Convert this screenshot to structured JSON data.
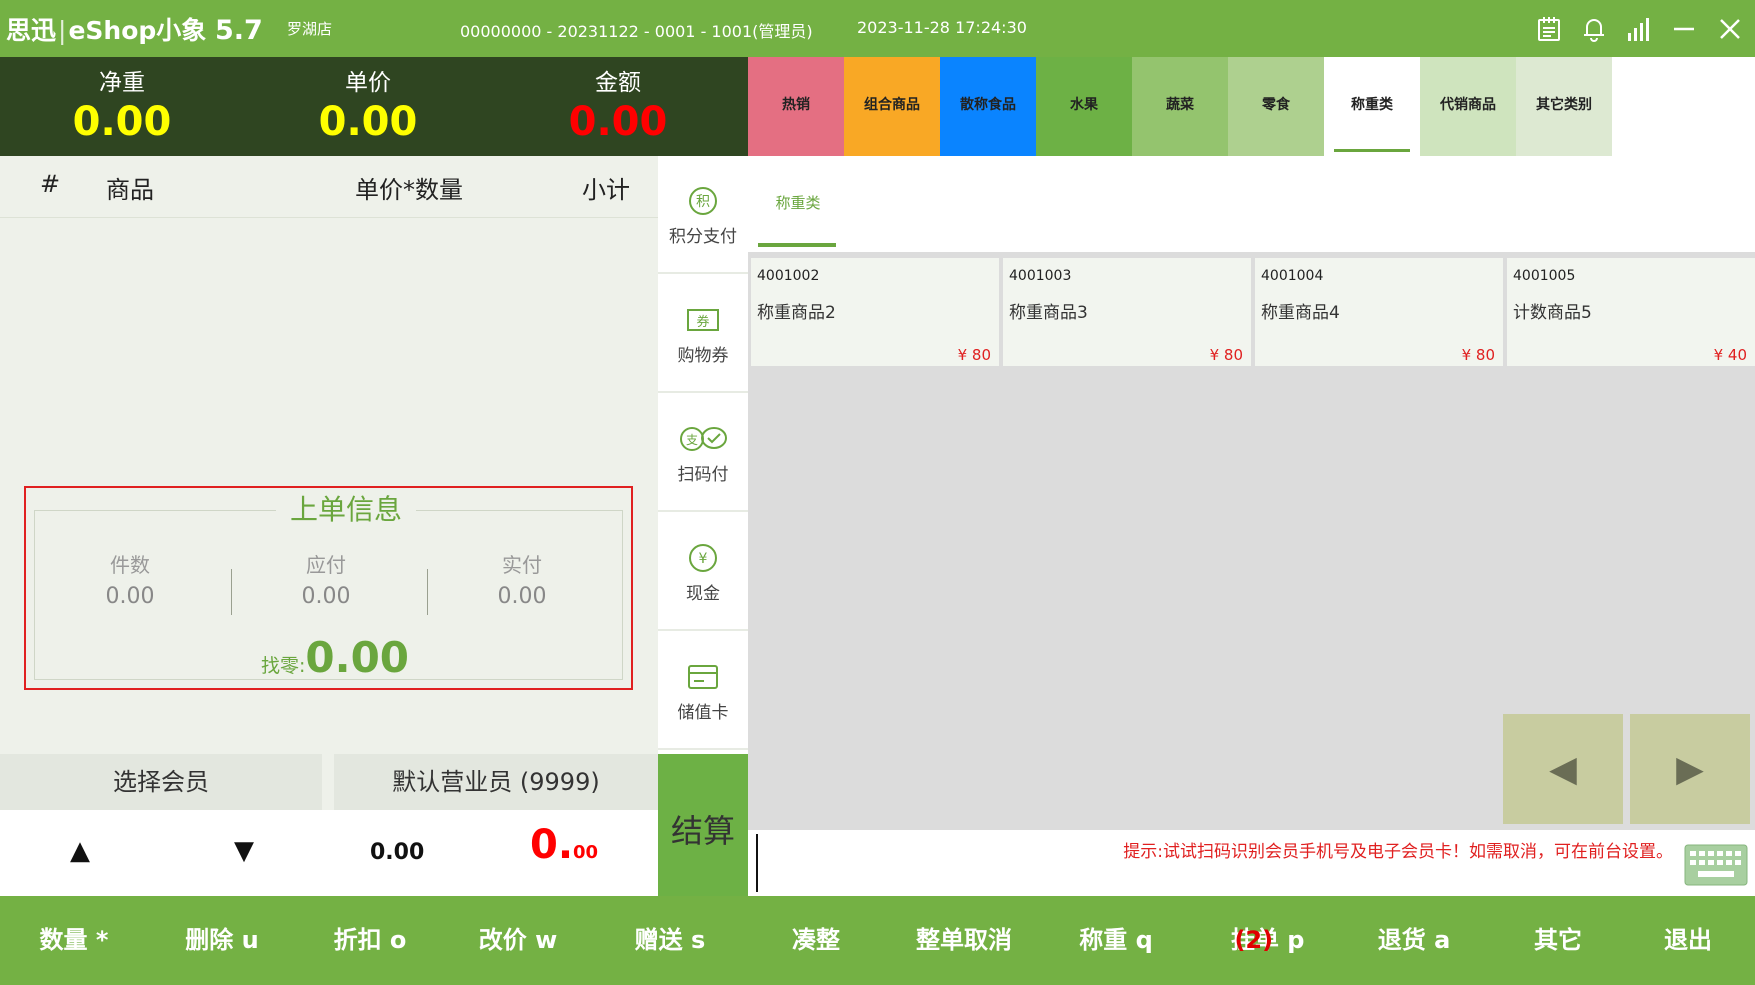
{
  "titlebar": {
    "brand": "思迅",
    "app_name": "eShop小象",
    "version": "5.7",
    "store": "罗湖店",
    "terminal": "00000000 - 20231122 - 0001 - 1001(管理员)",
    "datetime": "2023-11-28 17:24:30",
    "icons": [
      "clipboard-icon",
      "bell-icon",
      "signal-icon",
      "minimize-icon",
      "close-icon"
    ]
  },
  "display": {
    "net_weight_label": "净重",
    "net_weight_value": "0.00",
    "unit_price_label": "单价",
    "unit_price_value": "0.00",
    "amount_label": "金额",
    "amount_value": "0.00"
  },
  "cart": {
    "headers": {
      "index": "#",
      "product": "商品",
      "price_qty": "单价*数量",
      "subtotal": "小计"
    },
    "rows": []
  },
  "summary": {
    "title": "上单信息",
    "count_label": "件数",
    "count_value": "0.00",
    "payable_label": "应付",
    "payable_value": "0.00",
    "paid_label": "实付",
    "paid_value": "0.00",
    "change_label": "找零:",
    "change_value": "0.00"
  },
  "member": {
    "select_label": "选择会员",
    "clerk_label": "默认营业员 (9999)"
  },
  "totals": {
    "qty": "0.00",
    "amount_int": "0.",
    "amount_dec": "00"
  },
  "payments": [
    {
      "label": "积分支付",
      "icon": "points-icon"
    },
    {
      "label": "购物券",
      "icon": "coupon-icon"
    },
    {
      "label": "扫码付",
      "icon": "scan-pay-icon"
    },
    {
      "label": "现金",
      "icon": "cash-icon"
    },
    {
      "label": "储值卡",
      "icon": "stored-card-icon"
    }
  ],
  "checkout_label": "结算",
  "categories": [
    {
      "label": "热销",
      "color": "#e46f82"
    },
    {
      "label": "组合商品",
      "color": "#f9a825"
    },
    {
      "label": "散称食品",
      "color": "#0a84ff"
    },
    {
      "label": "水果",
      "color": "#6db145"
    },
    {
      "label": "蔬菜",
      "color": "#94c46e"
    },
    {
      "label": "零食",
      "color": "#aed08f"
    },
    {
      "label": "称重类",
      "color": "#ffffff",
      "active": true
    },
    {
      "label": "代销商品",
      "color": "#cfe4be"
    },
    {
      "label": "其它类别",
      "color": "#dde9d2"
    }
  ],
  "subcategory": "称重类",
  "products": [
    {
      "code": "4001002",
      "name": "称重商品2",
      "price": "¥ 80"
    },
    {
      "code": "4001003",
      "name": "称重商品3",
      "price": "¥ 80"
    },
    {
      "code": "4001004",
      "name": "称重商品4",
      "price": "¥ 80"
    },
    {
      "code": "4001005",
      "name": "计数商品5",
      "price": "¥ 40"
    }
  ],
  "pager": {
    "prev": "◀",
    "next": "▶"
  },
  "tip": "提示:试试扫码识别会员手机号及电子会员卡！如需取消，可在前台设置。",
  "functions": [
    {
      "label": "数量 *"
    },
    {
      "label": "删除 u"
    },
    {
      "label": "折扣 o"
    },
    {
      "label": "改价 w"
    },
    {
      "label": "赠送 s"
    },
    {
      "label": "凑整"
    },
    {
      "label": "整单取消"
    },
    {
      "label": "称重 q"
    },
    {
      "label": "挂单 p",
      "badge": "(2)"
    },
    {
      "label": "退货 a"
    },
    {
      "label": "其它"
    },
    {
      "label": "退出"
    }
  ],
  "colors": {
    "brand_green": "#74b144",
    "display_bg": "#2f4521",
    "yellow": "#ffff00",
    "red": "#ff0000"
  }
}
